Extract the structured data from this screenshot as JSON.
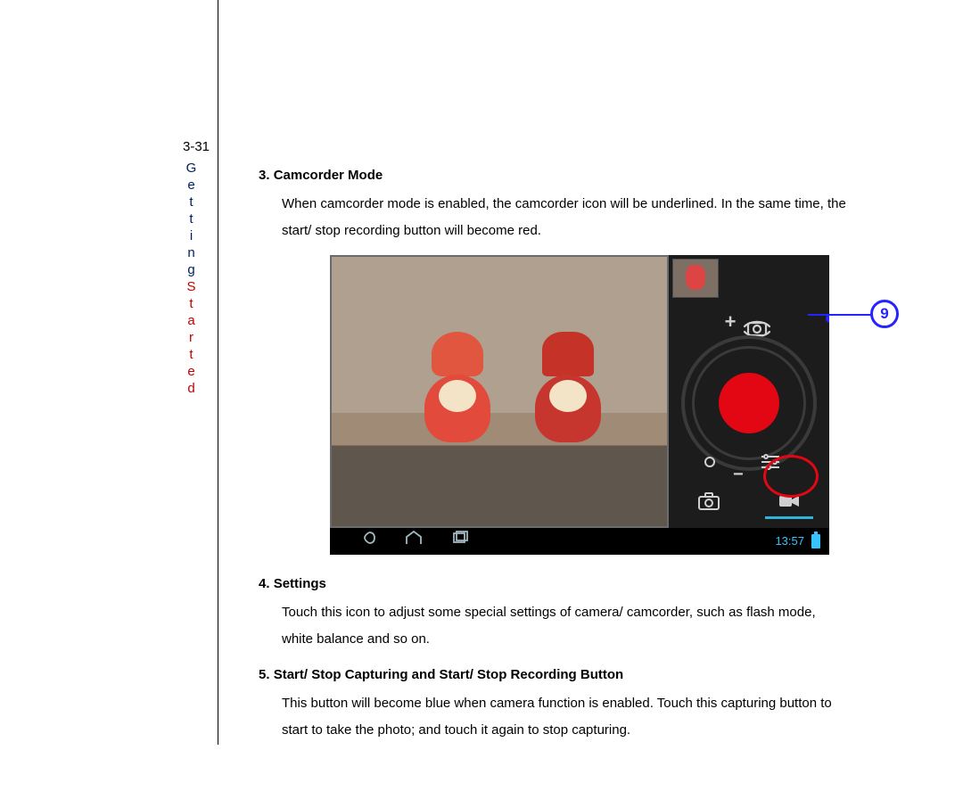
{
  "page_number": "3-31",
  "side_label": {
    "part1": "Getting",
    "part2": "Started"
  },
  "items": [
    {
      "num": "3.",
      "title": "Camcorder Mode",
      "body": "When camcorder mode is enabled, the camcorder icon will be underlined. In the same time, the start/ stop recording button will become red."
    },
    {
      "num": "4.",
      "title": "Settings",
      "body": "Touch this icon to adjust some special settings of camera/ camcorder, such as flash mode, white balance and so on."
    },
    {
      "num": "5.",
      "title": "Start/ Stop Capturing and Start/ Stop Recording Button",
      "body": "This button will become blue when camera function is enabled. Touch this capturing button to start to take the photo; and touch it again to stop capturing."
    }
  ],
  "callout": "9",
  "figure": {
    "clock": "13:57",
    "zoom_plus": "+",
    "dial_minus": "−"
  }
}
